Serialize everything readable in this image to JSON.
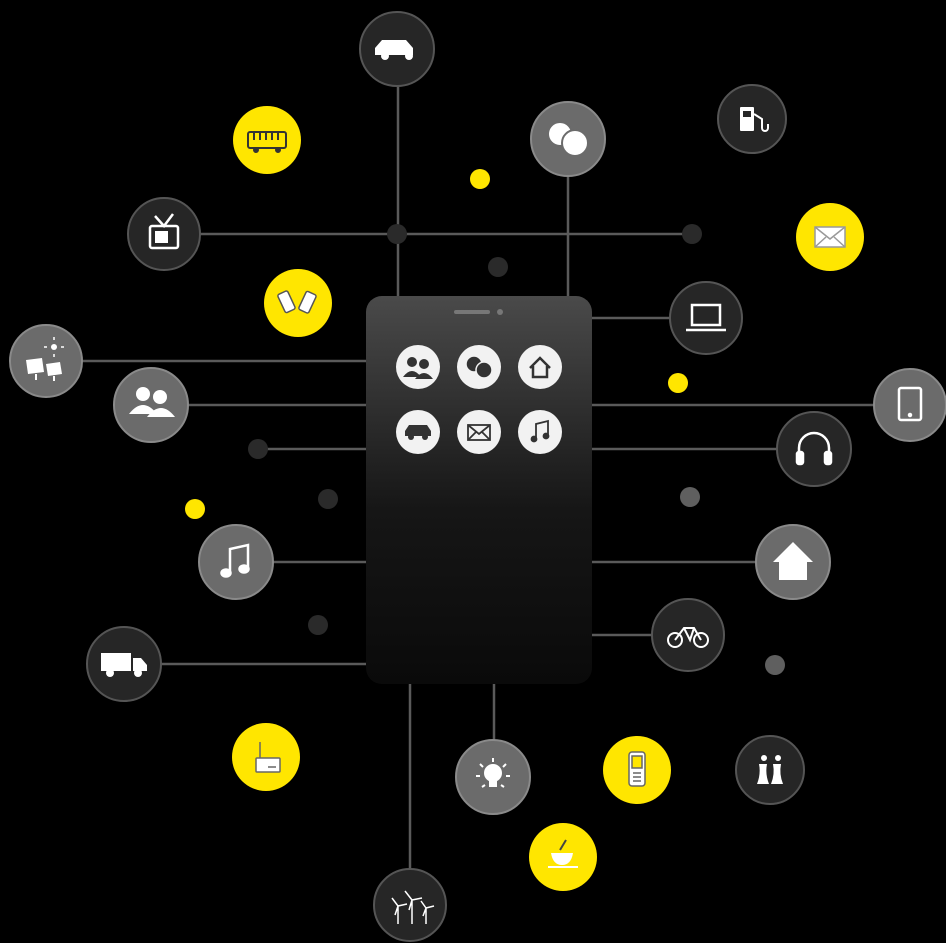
{
  "diagram": {
    "center_device": "smartphone-hub",
    "phone_apps": [
      {
        "icon": "people-icon"
      },
      {
        "icon": "chat-icon"
      },
      {
        "icon": "home-icon"
      },
      {
        "icon": "car-icon"
      },
      {
        "icon": "mail-icon"
      },
      {
        "icon": "music-icon"
      }
    ],
    "nodes": [
      {
        "icon": "car-icon",
        "style": "dark"
      },
      {
        "icon": "bus-icon",
        "style": "yellow"
      },
      {
        "icon": "chat-icon",
        "style": "grey"
      },
      {
        "icon": "fuel-pump-icon",
        "style": "dark"
      },
      {
        "icon": "tv-icon",
        "style": "dark"
      },
      {
        "icon": "mail-icon",
        "style": "yellow"
      },
      {
        "icon": "walkie-talkie-icon",
        "style": "yellow"
      },
      {
        "icon": "laptop-icon",
        "style": "dark"
      },
      {
        "icon": "solar-panel-icon",
        "style": "grey"
      },
      {
        "icon": "people-icon",
        "style": "grey"
      },
      {
        "icon": "tablet-icon",
        "style": "grey"
      },
      {
        "icon": "headphones-icon",
        "style": "dark"
      },
      {
        "icon": "music-icon",
        "style": "grey"
      },
      {
        "icon": "home-icon",
        "style": "grey"
      },
      {
        "icon": "truck-icon",
        "style": "dark"
      },
      {
        "icon": "bicycle-icon",
        "style": "dark"
      },
      {
        "icon": "router-icon",
        "style": "yellow"
      },
      {
        "icon": "lightbulb-icon",
        "style": "grey"
      },
      {
        "icon": "mobile-phone-icon",
        "style": "yellow"
      },
      {
        "icon": "power-plant-icon",
        "style": "dark"
      },
      {
        "icon": "coffee-cup-icon",
        "style": "yellow"
      },
      {
        "icon": "wind-turbine-icon",
        "style": "dark"
      }
    ],
    "colors": {
      "background": "#000000",
      "accent_yellow": "#ffe600",
      "node_dark": "#262626",
      "node_grey": "#6b6b6b",
      "phone_top": "#4a4a4a",
      "phone_bottom": "#0a0a0a"
    }
  }
}
